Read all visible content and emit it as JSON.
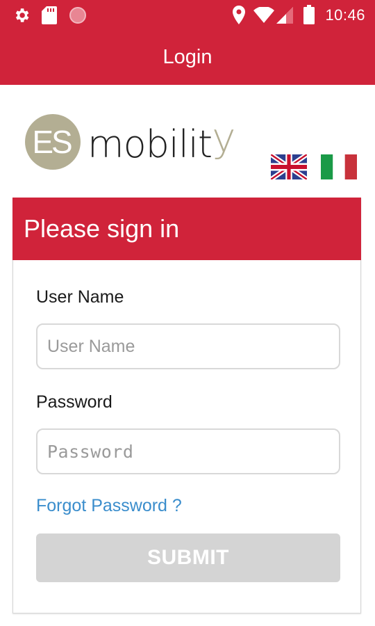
{
  "status_bar": {
    "time": "10:46",
    "left_icons": [
      "gear-icon",
      "sd-card-icon",
      "record-icon"
    ],
    "right_icons": [
      "location-pin-icon",
      "wifi-icon",
      "cell-signal-icon",
      "battery-icon"
    ]
  },
  "app_bar": {
    "title": "Login"
  },
  "logo": {
    "monogram": "ES",
    "wordmark_main": "mobilit",
    "wordmark_tail": "y"
  },
  "languages": [
    "flag-uk-icon",
    "flag-italy-icon"
  ],
  "form": {
    "heading": "Please sign in",
    "username_label": "User Name",
    "username_placeholder": "User Name",
    "username_value": "",
    "password_label": "Password",
    "password_placeholder": "Password",
    "password_value": "",
    "forgot_link": "Forgot Password ?",
    "submit_label": "SUBMIT"
  },
  "colors": {
    "brand_red": "#d0233a",
    "logo_olive": "#b3ae93",
    "link_blue": "#3a8dcc",
    "disabled_button": "#d4d4d4"
  }
}
